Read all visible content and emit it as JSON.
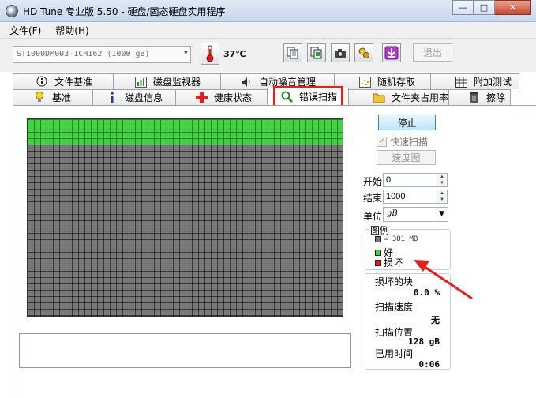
{
  "window": {
    "title": "HD Tune 专业版 5.50 - 硬盘/固态硬盘实用程序",
    "controls": {
      "minimize": "—",
      "maximize": "□",
      "close": "✕"
    }
  },
  "menu": [
    "文件(F)",
    "帮助(H)"
  ],
  "toolbar": {
    "drive": "ST1000DM003-1CH162 (1000 gB)",
    "temperature": "37℃",
    "exit_label": "退出",
    "buttons": [
      "copy-text-icon",
      "copy-screenshot-icon",
      "camera-icon",
      "options-icon",
      "save-icon"
    ]
  },
  "tabs": {
    "row1": [
      "文件基准",
      "磁盘监视器",
      "自动噪音管理",
      "随机存取",
      "附加测试"
    ],
    "row2": [
      "基准",
      "磁盘信息",
      "健康状态",
      "错误扫描",
      "文件夹占用率",
      "擦除"
    ],
    "active": "错误扫描"
  },
  "scan": {
    "progress_fraction": 0.128,
    "stop_label": "停止",
    "quick_scan_label": "快速扫描",
    "quick_scan_checked": true,
    "speed_map_label": "速度图",
    "start_label": "开始",
    "start_value": "0",
    "end_label": "结束",
    "end_value": "1000",
    "unit_label": "单位",
    "unit_value": "gB"
  },
  "legend": {
    "title": "图例",
    "block_size": "= 381 MB",
    "good": "好",
    "damaged": "损坏",
    "colors": {
      "block": "#787878",
      "good": "#44cf44",
      "damaged": "#e02020"
    }
  },
  "stats": {
    "damaged_blocks_label": "损坏的块",
    "damaged_blocks_value": "0.0 %",
    "scan_speed_label": "扫描速度",
    "scan_speed_value": "无",
    "scan_position_label": "扫描位置",
    "scan_position_value": "128 gB",
    "elapsed_label": "已用时间",
    "elapsed_value": "0:06"
  },
  "annotation": {
    "highlight_color": "#e2211c"
  }
}
